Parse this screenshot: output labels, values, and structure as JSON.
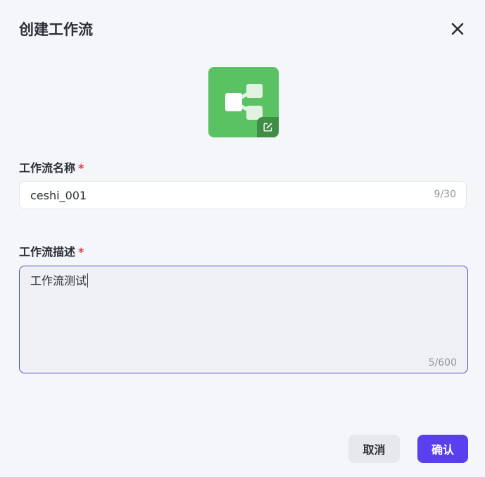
{
  "dialog": {
    "title": "创建工作流",
    "close_icon": "close-icon"
  },
  "workflow_icon": {
    "icon": "workflow-nodes-icon",
    "edit_icon": "edit-icon",
    "background_color": "#5ac262"
  },
  "name_field": {
    "label": "工作流名称",
    "required_mark": "*",
    "value": "ceshi_001",
    "counter": "9/30"
  },
  "desc_field": {
    "label": "工作流描述",
    "required_mark": "*",
    "value": "工作流测试",
    "counter": "5/600"
  },
  "actions": {
    "cancel_label": "取消",
    "confirm_label": "确认"
  },
  "colors": {
    "accent": "#5a3ff0",
    "required": "#e53935",
    "focus_border": "#4b4fd3"
  }
}
